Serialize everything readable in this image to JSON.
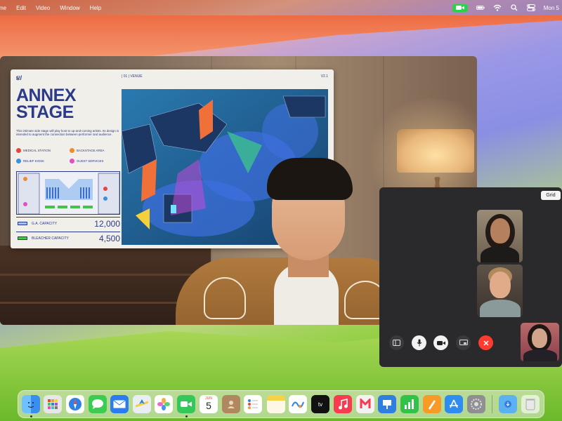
{
  "menubar": {
    "items": [
      "me",
      "Edit",
      "Video",
      "Window",
      "Help"
    ],
    "clock": "Mon 5",
    "status_icons": [
      "facetime-pill-icon",
      "battery-icon",
      "wifi-icon",
      "search-icon",
      "control-center-icon"
    ]
  },
  "main_window": {
    "board": {
      "logo": "૪/",
      "venue": "| 01 | VENUE",
      "version": "V2.1",
      "title_line1": "ANNEX",
      "title_line2": "STAGE",
      "description": "This intimate side stage will play host to up-and-coming artists. Its design is intended to augment the connection between performer and audience.",
      "legend": [
        {
          "label": "MEDICAL STATION",
          "color": "#e8453c"
        },
        {
          "label": "BACKSTAGE AREA",
          "color": "#f08a2c"
        },
        {
          "label": "RELIEF KIOSK",
          "color": "#3a8fe0"
        },
        {
          "label": "GUEST SERVICES",
          "color": "#e24fc4"
        }
      ],
      "capacities": [
        {
          "label": "G.A. CAPACITY",
          "value": "12,000",
          "swatch": "#9ec3ef"
        },
        {
          "label": "BLEACHER CAPACITY",
          "value": "4,500",
          "swatch": "#45c24a"
        }
      ]
    }
  },
  "side_window": {
    "grid_label": "Grid",
    "controls": [
      {
        "name": "sidebar-toggle-button",
        "icon": "sidebar-icon"
      },
      {
        "name": "microphone-button",
        "icon": "microphone-icon"
      },
      {
        "name": "camera-button",
        "icon": "video-camera-icon"
      },
      {
        "name": "share-screen-button",
        "icon": "screen-share-icon"
      },
      {
        "name": "end-call-button",
        "icon": "close-icon"
      }
    ]
  },
  "dock": {
    "calendar_month": "JUN",
    "calendar_day": "5",
    "apps": [
      "finder",
      "launchpad",
      "safari",
      "messages",
      "mail",
      "maps",
      "photos",
      "facetime",
      "calendar",
      "contacts",
      "reminders",
      "notes",
      "freeform",
      "tv",
      "music",
      "news",
      "keynote",
      "numbers",
      "pages",
      "app-store",
      "system-settings",
      "downloads",
      "trash"
    ],
    "colors": {
      "finder": "#3a8ef0",
      "safari": "#2f7fe6",
      "messages": "#3ccc52",
      "mail": "#2a7cf0",
      "facetime": "#34c85a",
      "tv": "#111111",
      "music": "#fa3a4e",
      "news": "#f2f2f2",
      "keynote": "#2f7fe0",
      "numbers": "#32c24a",
      "pages": "#f79a28",
      "app-store": "#2f8cf0"
    }
  }
}
